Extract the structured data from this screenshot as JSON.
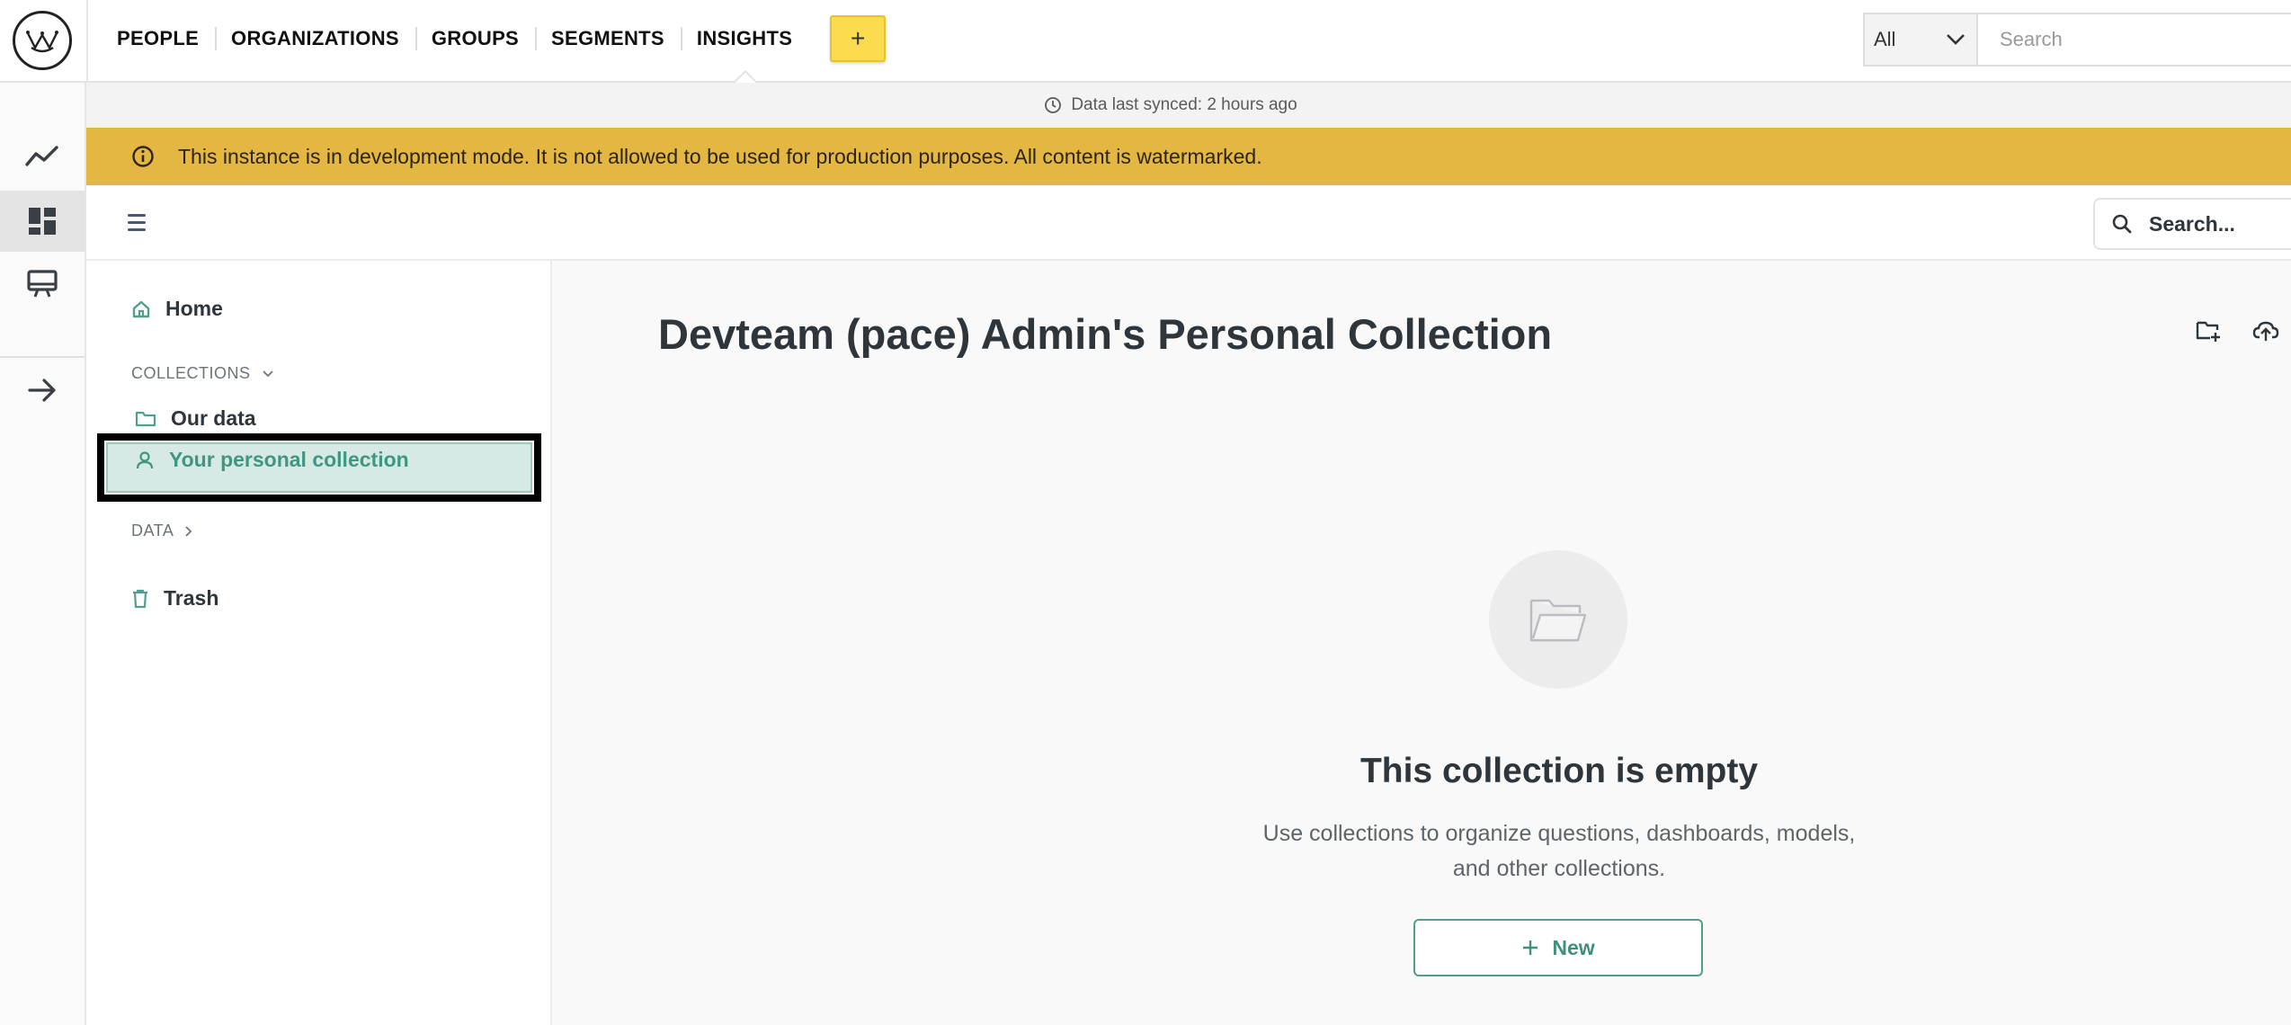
{
  "topnav": {
    "items": [
      {
        "label": "PEOPLE"
      },
      {
        "label": "ORGANIZATIONS"
      },
      {
        "label": "GROUPS"
      },
      {
        "label": "SEGMENTS"
      },
      {
        "label": "INSIGHTS",
        "active": true
      }
    ],
    "add_label": "+",
    "scope_select": "All",
    "search_placeholder": "Search"
  },
  "sync": {
    "text": "Data last synced: 2 hours ago"
  },
  "banner": {
    "text": "This instance is in development mode. It is not allowed to be used for production purposes. All content is watermarked.",
    "color": "#e3b742"
  },
  "app_header": {
    "search_label": "Search..."
  },
  "sidebar": {
    "home": "Home",
    "collections_label": "COLLECTIONS",
    "our_data": "Our data",
    "personal_collection": "Your personal collection",
    "data_label": "DATA",
    "trash": "Trash"
  },
  "main": {
    "title": "Devteam (pace) Admin's Personal Collection",
    "empty_title": "This collection is empty",
    "empty_desc": "Use collections to organize questions, dashboards, models, and other collections.",
    "new_label": "New"
  },
  "colors": {
    "brand_green": "#509e8c",
    "accent_yellow": "#fbdb4f",
    "selected_bg": "#d7e9e5"
  }
}
